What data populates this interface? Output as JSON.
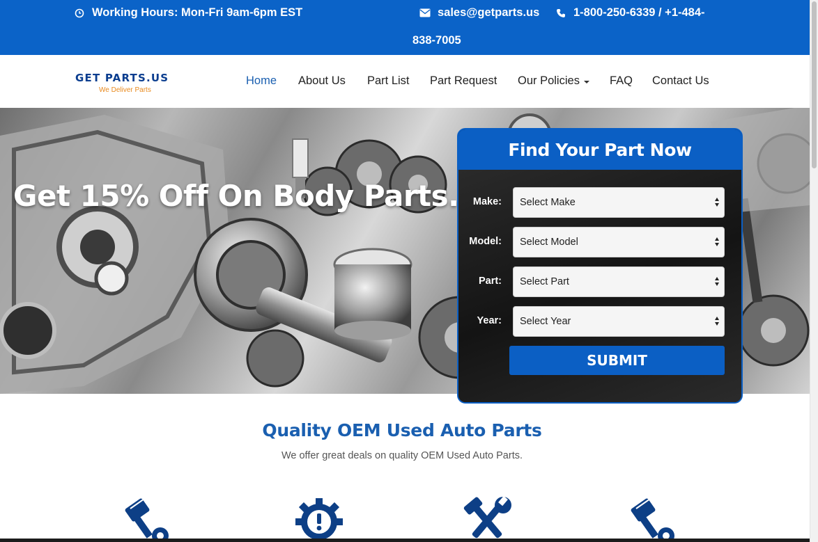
{
  "topbar": {
    "hours": "Working Hours: Mon-Fri 9am-6pm EST",
    "email": "sales@getparts.us",
    "phone_line1": "1-800-250-6339 / +1-484-",
    "phone_line2": "838-7005",
    "icons": [
      "clock-icon",
      "envelope-icon",
      "phone-icon"
    ]
  },
  "logo": {
    "name": "GET PARTS.US",
    "tagline": "We Deliver Parts"
  },
  "nav": {
    "items": [
      {
        "label": "Home",
        "active": true
      },
      {
        "label": "About Us"
      },
      {
        "label": "Part List"
      },
      {
        "label": "Part Request"
      },
      {
        "label": "Our Policies",
        "dropdown": true
      },
      {
        "label": "FAQ"
      },
      {
        "label": "Contact Us"
      }
    ]
  },
  "hero": {
    "headline": "Get 15% Off On Body Parts."
  },
  "finder": {
    "title": "Find Your Part Now",
    "fields": [
      {
        "label": "Make:",
        "value": "Select Make"
      },
      {
        "label": "Model:",
        "value": "Select Model"
      },
      {
        "label": "Part:",
        "value": "Select Part"
      },
      {
        "label": "Year:",
        "value": "Select Year"
      }
    ],
    "submit": "SUBMIT"
  },
  "section": {
    "title": "Quality OEM Used Auto Parts",
    "subtitle": "We offer great deals on quality OEM Used Auto Parts."
  },
  "features": [
    "piston-icon",
    "gear-warning-icon",
    "tools-icon",
    "piston-icon"
  ],
  "colors": {
    "brand_blue": "#0b63c8",
    "title_blue": "#1a5fb0",
    "logo_orange": "#e8891d"
  }
}
